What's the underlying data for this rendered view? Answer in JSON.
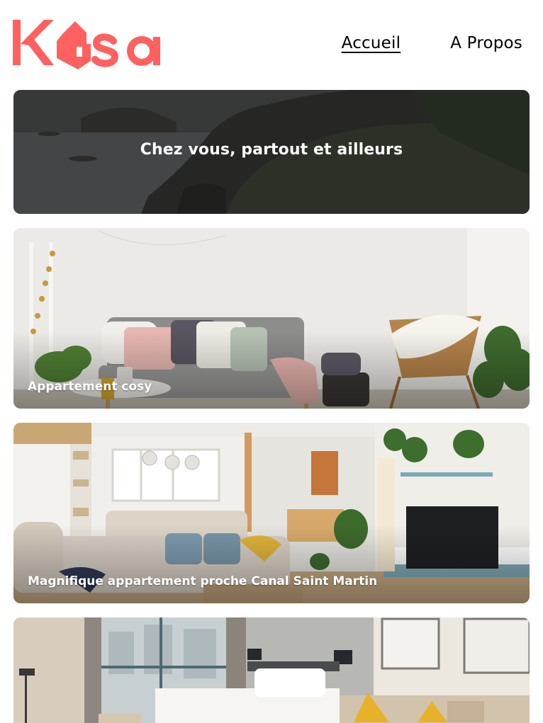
{
  "brand": {
    "name": "Kasa",
    "color": "#FF6060"
  },
  "nav": {
    "home_label": "Accueil",
    "about_label": "A Propos"
  },
  "banner": {
    "title": "Chez vous, partout et ailleurs"
  },
  "listings": [
    {
      "title": "Appartement cosy"
    },
    {
      "title": "Magnifique appartement proche Canal Saint Martin"
    },
    {
      "title": ""
    }
  ]
}
